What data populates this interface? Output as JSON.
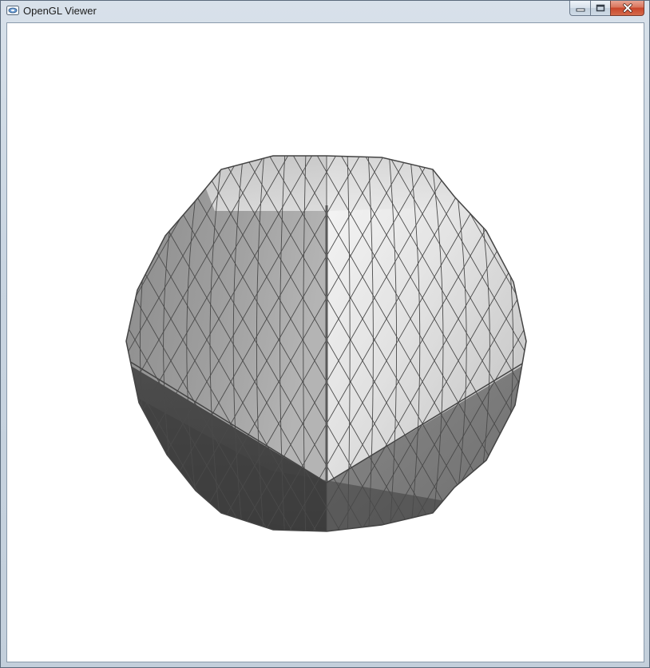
{
  "window": {
    "title": "OpenGL Viewer",
    "icon": "opengl-app-icon",
    "controls": {
      "minimize": "minimize-icon",
      "maximize": "maximize-icon",
      "close": "close-icon"
    }
  },
  "viewport": {
    "background": "#ffffff",
    "model": "geodesic-tessellated-sphere",
    "mesh_color": "#4a4a4a",
    "shades": [
      "#f4f4f4",
      "#d2d2d2",
      "#a6a6a6",
      "#7a7a7a",
      "#4e4e4e",
      "#3a3a3a"
    ]
  }
}
